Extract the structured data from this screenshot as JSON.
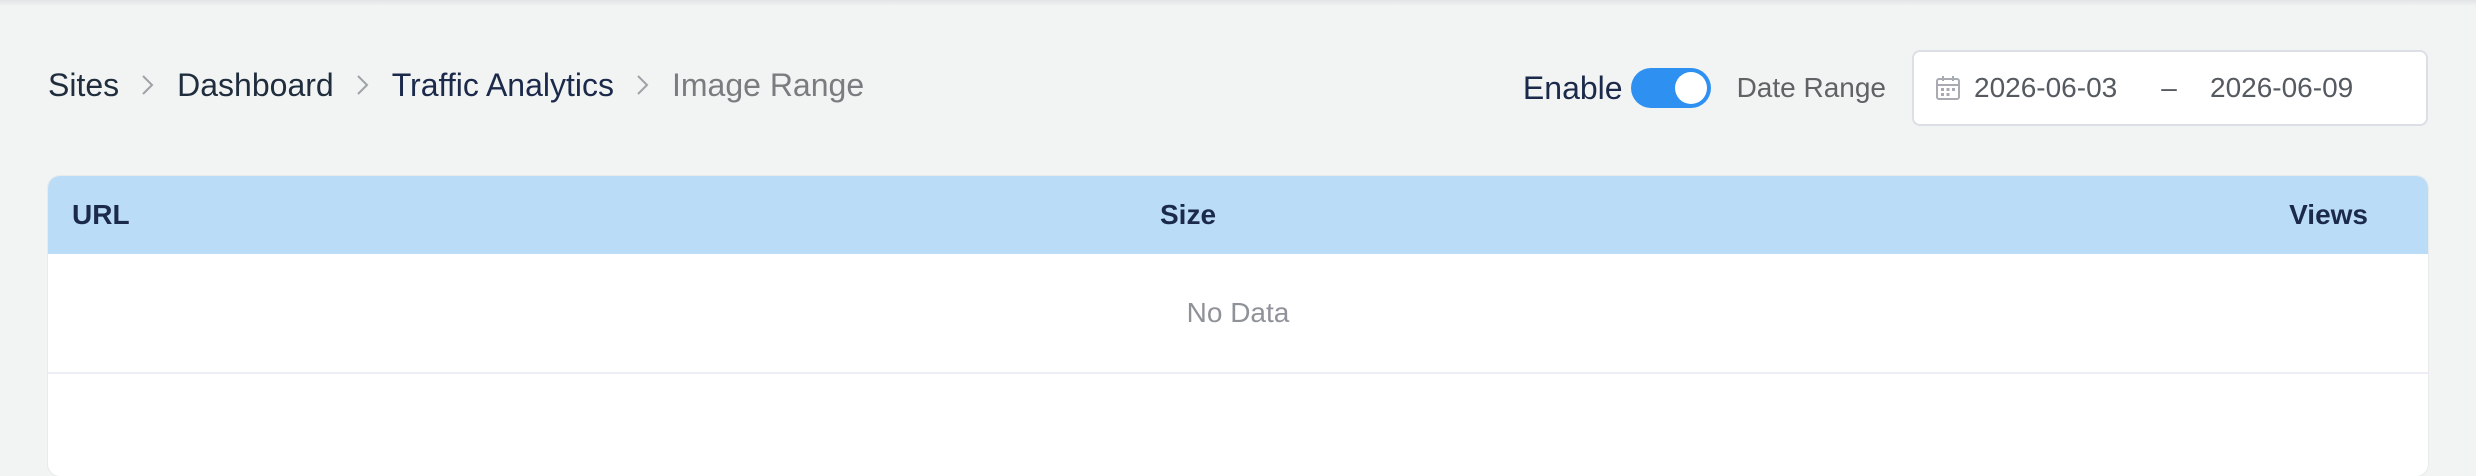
{
  "breadcrumb": {
    "items": [
      {
        "label": "Sites"
      },
      {
        "label": "Dashboard"
      },
      {
        "label": "Traffic Analytics"
      },
      {
        "label": "Image Range"
      }
    ]
  },
  "controls": {
    "enable_label": "Enable",
    "enable_on": true,
    "date_range_label": "Date Range",
    "date_start": "2026-06-03",
    "date_separator": "–",
    "date_end": "2026-06-09",
    "calendar_icon": "calendar-icon"
  },
  "table": {
    "columns": [
      "URL",
      "Size",
      "Views"
    ],
    "empty_text": "No Data"
  },
  "colors": {
    "accent": "#2e90f0",
    "table_header_bg": "#bbdcf7",
    "page_bg": "#f2f3f3"
  }
}
